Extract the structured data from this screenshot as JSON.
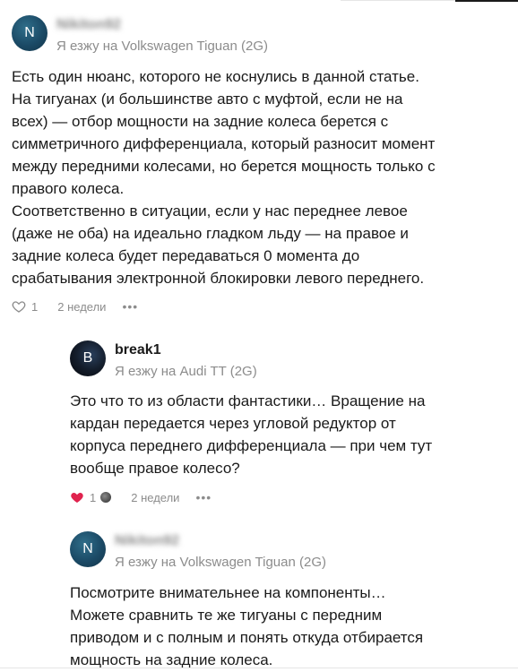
{
  "comments": [
    {
      "avatar_letter": "N",
      "author": "Nikiton92",
      "car": "Я езжу на Volkswagen Tiguan (2G)",
      "paragraphs": [
        "Есть один нюанс, которого не коснулись в данной статье.",
        "На тигуанах (и большинстве авто с муфтой, если не на",
        "всех) — отбор мощности на задние колеса берется с",
        "симметричного дифференциала, который разносит момент",
        "между передними колесами, но берется мощность только с",
        "правого колеса.",
        "Соответственно в ситуации, если у нас переднее левое",
        "(даже не оба) на идеально гладком льду — на правое и",
        "задние колеса будет передаваться 0 момента до",
        "срабатывания электронной блокировки левого переднего."
      ],
      "likes": "1",
      "liked": false,
      "time": "2 недели",
      "more": "•••"
    },
    {
      "avatar_letter": "B",
      "author": "break1",
      "car": "Я езжу на Audi TT (2G)",
      "paragraphs": [
        "Это что то из области фантастики… Вращение на",
        "кардан передается через угловой редуктор от",
        "корпуса переднего дифференциала — при чем тут",
        "вообще правое колесо?"
      ],
      "likes": "1",
      "liked": true,
      "time": "2 недели",
      "more": "•••"
    },
    {
      "avatar_letter": "N",
      "author": "Nikiton92",
      "car": "Я езжу на Volkswagen Tiguan (2G)",
      "paragraphs": [
        "Посмотрите внимательнее на компоненты…",
        "Можете сравнить те же тигуаны с передним",
        "приводом и с полным и понять откуда отбирается",
        "мощность на задние колеса."
      ]
    }
  ],
  "colors": {
    "liked_heart": "#e0234e",
    "muted_text": "#8c8c8c"
  },
  "icons": {
    "like_outline": "heart-outline-icon",
    "like_filled": "heart-filled-icon",
    "more": "more-dots-icon"
  }
}
